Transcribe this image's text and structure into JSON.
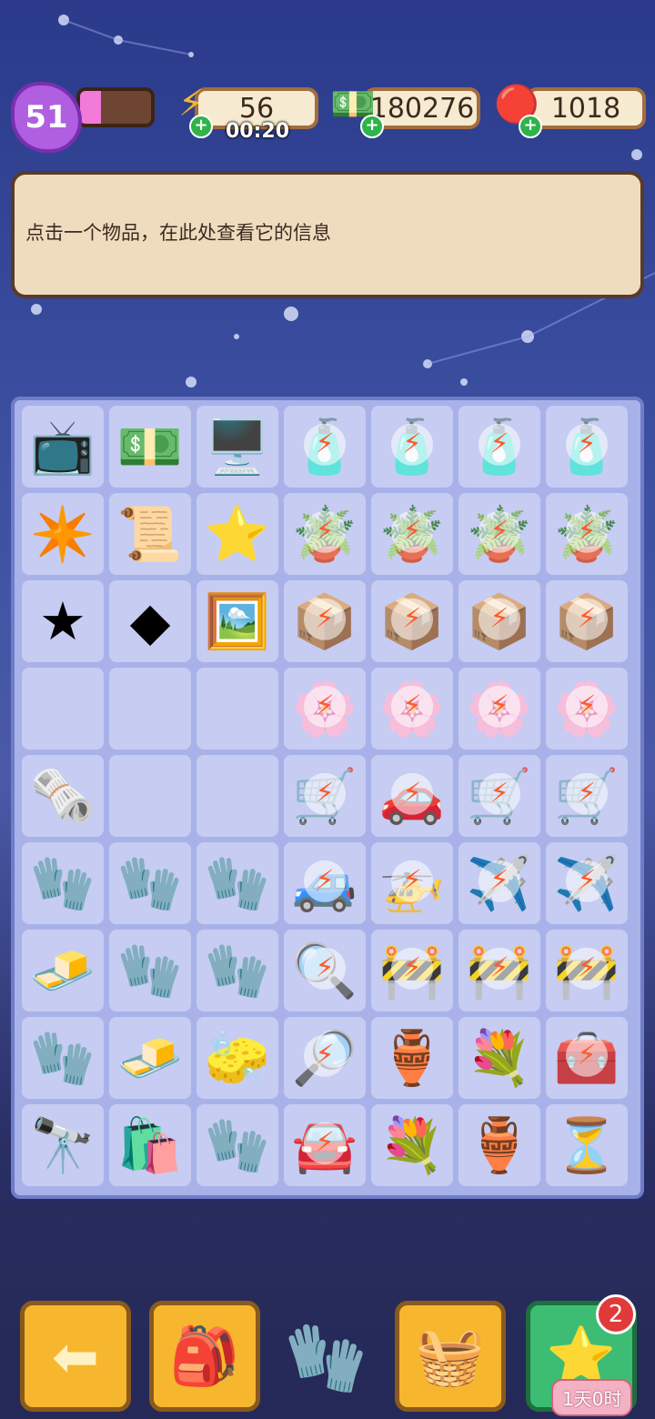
{
  "hud": {
    "level": "51",
    "xp_progress": 0.3,
    "energy": "56",
    "energy_timer": "00:20",
    "cash": "180276",
    "gems": "1018"
  },
  "info_panel": {
    "text": "点击一个物品，在此处查看它的信息"
  },
  "board": {
    "columns": 7,
    "cells": [
      {
        "icon": "tv-icon",
        "glyph": "📺",
        "locked": false
      },
      {
        "icon": "cash-pile-icon",
        "glyph": "💵",
        "locked": false
      },
      {
        "icon": "retro-computer-icon",
        "glyph": "🖥️",
        "locked": false
      },
      {
        "icon": "medicine-bottle-icon",
        "glyph": "🧴",
        "locked": true
      },
      {
        "icon": "medicine-bottle-icon",
        "glyph": "🧴",
        "locked": true
      },
      {
        "icon": "medicine-bottle-icon",
        "glyph": "🧴",
        "locked": true
      },
      {
        "icon": "medicine-bottle-icon",
        "glyph": "🧴",
        "locked": true
      },
      {
        "icon": "purple-star-cookie-icon",
        "glyph": "✴️",
        "locked": false
      },
      {
        "icon": "treasure-map-icon",
        "glyph": "📜",
        "locked": false
      },
      {
        "icon": "purple-star-face-icon",
        "glyph": "⭐",
        "locked": false
      },
      {
        "icon": "potted-plant-icon",
        "glyph": "🪴",
        "locked": true
      },
      {
        "icon": "potted-plant-icon",
        "glyph": "🪴",
        "locked": true
      },
      {
        "icon": "potted-plant-icon",
        "glyph": "🪴",
        "locked": true
      },
      {
        "icon": "potted-plant-icon",
        "glyph": "🪴",
        "locked": true
      },
      {
        "icon": "purple-star-icon",
        "glyph": "★",
        "locked": false
      },
      {
        "icon": "purple-gem-icon",
        "glyph": "◆",
        "locked": false
      },
      {
        "icon": "chalkboard-icon",
        "glyph": "🖼️",
        "locked": false
      },
      {
        "icon": "wooden-crate-icon",
        "glyph": "📦",
        "locked": true
      },
      {
        "icon": "wooden-crate-icon",
        "glyph": "📦",
        "locked": true
      },
      {
        "icon": "wooden-crate-icon",
        "glyph": "📦",
        "locked": true
      },
      {
        "icon": "wooden-crate-icon",
        "glyph": "📦",
        "locked": true
      },
      {
        "icon": "empty",
        "glyph": "",
        "locked": false
      },
      {
        "icon": "empty",
        "glyph": "",
        "locked": false
      },
      {
        "icon": "empty",
        "glyph": "",
        "locked": false
      },
      {
        "icon": "blossom-tree-icon",
        "glyph": "🌸",
        "locked": true
      },
      {
        "icon": "blossom-tree-icon",
        "glyph": "🌸",
        "locked": true
      },
      {
        "icon": "blossom-tree-icon",
        "glyph": "🌸",
        "locked": true
      },
      {
        "icon": "blossom-tree-icon",
        "glyph": "🌸",
        "locked": true
      },
      {
        "icon": "photo-bag-icon",
        "glyph": "🗞️",
        "locked": false
      },
      {
        "icon": "empty",
        "glyph": "",
        "locked": false
      },
      {
        "icon": "empty",
        "glyph": "",
        "locked": false
      },
      {
        "icon": "stroller-icon",
        "glyph": "🛒",
        "locked": true
      },
      {
        "icon": "toy-car-icon",
        "glyph": "🚗",
        "locked": true
      },
      {
        "icon": "pink-stroller-icon",
        "glyph": "🛒",
        "locked": true
      },
      {
        "icon": "pink-stroller-icon",
        "glyph": "🛒",
        "locked": true
      },
      {
        "icon": "red-glove-icon",
        "glyph": "🧤",
        "locked": false
      },
      {
        "icon": "red-glove-icon",
        "glyph": "🧤",
        "locked": false
      },
      {
        "icon": "red-glove-icon",
        "glyph": "🧤",
        "locked": false
      },
      {
        "icon": "jeep-icon",
        "glyph": "🚙",
        "locked": true
      },
      {
        "icon": "helicopter-icon",
        "glyph": "🚁",
        "locked": true
      },
      {
        "icon": "airplane-icon",
        "glyph": "✈️",
        "locked": true
      },
      {
        "icon": "airplane-icon",
        "glyph": "✈️",
        "locked": true
      },
      {
        "icon": "bread-cubes-icon",
        "glyph": "🧈",
        "locked": false
      },
      {
        "icon": "red-glove-icon",
        "glyph": "🧤",
        "locked": false
      },
      {
        "icon": "white-glove-icon",
        "glyph": "🧤",
        "locked": false
      },
      {
        "icon": "crime-scene-icon",
        "glyph": "🔍",
        "locked": true
      },
      {
        "icon": "crime-scene-box-icon",
        "glyph": "🚧",
        "locked": true
      },
      {
        "icon": "police-tape-icon",
        "glyph": "🚧",
        "locked": true
      },
      {
        "icon": "police-tape-icon",
        "glyph": "🚧",
        "locked": true
      },
      {
        "icon": "red-glove-icon",
        "glyph": "🧤",
        "locked": false
      },
      {
        "icon": "bread-cubes-icon",
        "glyph": "🧈",
        "locked": false
      },
      {
        "icon": "green-sponge-icon",
        "glyph": "🧽",
        "locked": false
      },
      {
        "icon": "magnifier-evidence-icon",
        "glyph": "🔎",
        "locked": true
      },
      {
        "icon": "dragon-vase-icon",
        "glyph": "🏺",
        "locked": false
      },
      {
        "icon": "flower-bouquet-icon",
        "glyph": "💐",
        "locked": false
      },
      {
        "icon": "toolbox-icon",
        "glyph": "🧰",
        "locked": true
      },
      {
        "icon": "telescope-icon",
        "glyph": "🔭",
        "locked": false
      },
      {
        "icon": "evidence-bag-icon",
        "glyph": "🛍️",
        "locked": false
      },
      {
        "icon": "red-glove-icon",
        "glyph": "🧤",
        "locked": false
      },
      {
        "icon": "purple-car-icon",
        "glyph": "🚘",
        "locked": true
      },
      {
        "icon": "flower-bouquet-icon",
        "glyph": "💐",
        "locked": false
      },
      {
        "icon": "dragon-vase-icon",
        "glyph": "🏺",
        "locked": false
      },
      {
        "icon": "hourglass-icon",
        "glyph": "⏳",
        "locked": false
      }
    ]
  },
  "bottom": {
    "back_icon": "arrow-left-icon",
    "backpack_icon": "backpack-icon",
    "center_icon": "white-glove-icon",
    "basket_icon": "basket-icon",
    "event_badge": "2",
    "event_timer": "1天0时"
  },
  "colors": {
    "panel_bg": "#efdcbe",
    "board_bg": "#a9b2e8",
    "cell_bg": "#c6ccf2",
    "button_yellow": "#f6b62e",
    "button_green": "#3dbd74"
  }
}
